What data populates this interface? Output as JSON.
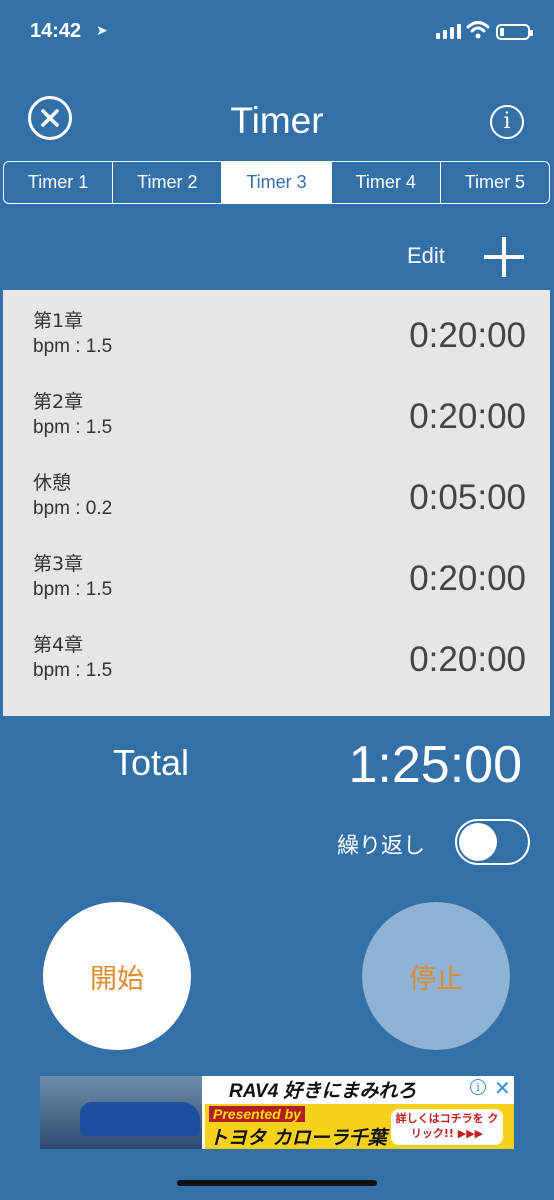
{
  "status_bar": {
    "time": "14:42"
  },
  "header": {
    "title": "Timer"
  },
  "tabs": [
    {
      "label": "Timer 1",
      "active": false
    },
    {
      "label": "Timer 2",
      "active": false
    },
    {
      "label": "Timer 3",
      "active": true
    },
    {
      "label": "Timer 4",
      "active": false
    },
    {
      "label": "Timer 5",
      "active": false
    }
  ],
  "toolbar": {
    "edit_label": "Edit"
  },
  "timers": [
    {
      "name": "第1章",
      "bpm": "bpm : 1.5",
      "duration": "0:20:00"
    },
    {
      "name": "第2章",
      "bpm": "bpm : 1.5",
      "duration": "0:20:00"
    },
    {
      "name": "休憩",
      "bpm": "bpm : 0.2",
      "duration": "0:05:00"
    },
    {
      "name": "第3章",
      "bpm": "bpm : 1.5",
      "duration": "0:20:00"
    },
    {
      "name": "第4章",
      "bpm": "bpm : 1.5",
      "duration": "0:20:00"
    }
  ],
  "summary": {
    "total_label": "Total",
    "total_value": "1:25:00",
    "repeat_label": "繰り返し",
    "repeat_on": false
  },
  "controls": {
    "start_label": "開始",
    "stop_label": "停止"
  },
  "ad": {
    "headline": "RAV4 好きにまみれろ",
    "presented": "Presented by",
    "brand": "トヨタ カローラ千葉",
    "cta": "詳しくはコチラを クリック!! ▶▶▶"
  },
  "colors": {
    "background": "#3370a8",
    "accent": "#e08a2a",
    "list_bg": "#e6e6e6"
  }
}
